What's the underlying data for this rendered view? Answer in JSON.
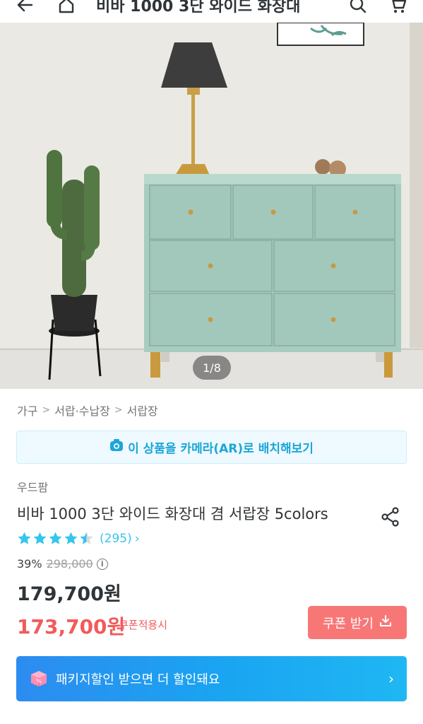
{
  "topbar": {
    "title": "비바 1000 3단 와이드 화장대",
    "back_icon": "back-arrow-icon",
    "home_icon": "home-icon",
    "search_icon": "search-icon",
    "cart_icon": "cart-icon"
  },
  "gallery": {
    "counter": "1/8"
  },
  "breadcrumb": {
    "items": [
      "가구",
      "서랍·수납장",
      "서랍장"
    ]
  },
  "ar_banner": {
    "label": "이 상품을 카메라(AR)로 배치해보기",
    "icon": "camera-icon"
  },
  "product": {
    "brand": "우드팜",
    "title": "비바 1000 3단 와이드 화장대 겸 서랍장 5colors",
    "rating_value": 4.5,
    "review_count": "(295)",
    "discount_pct": "39%",
    "original_price": "298,000",
    "price": "179,700원",
    "coupon_price": "173,700원",
    "coupon_note": "쿠폰적용시",
    "coupon_button": "쿠폰 받기"
  },
  "package_banner": {
    "label": "패키지할인 받으면 더 할인돼요"
  },
  "colors": {
    "accent": "#35c5f0",
    "coupon_red": "#f25b5b",
    "coupon_button": "#f77777",
    "banner_blue": "#1aa3f1"
  }
}
